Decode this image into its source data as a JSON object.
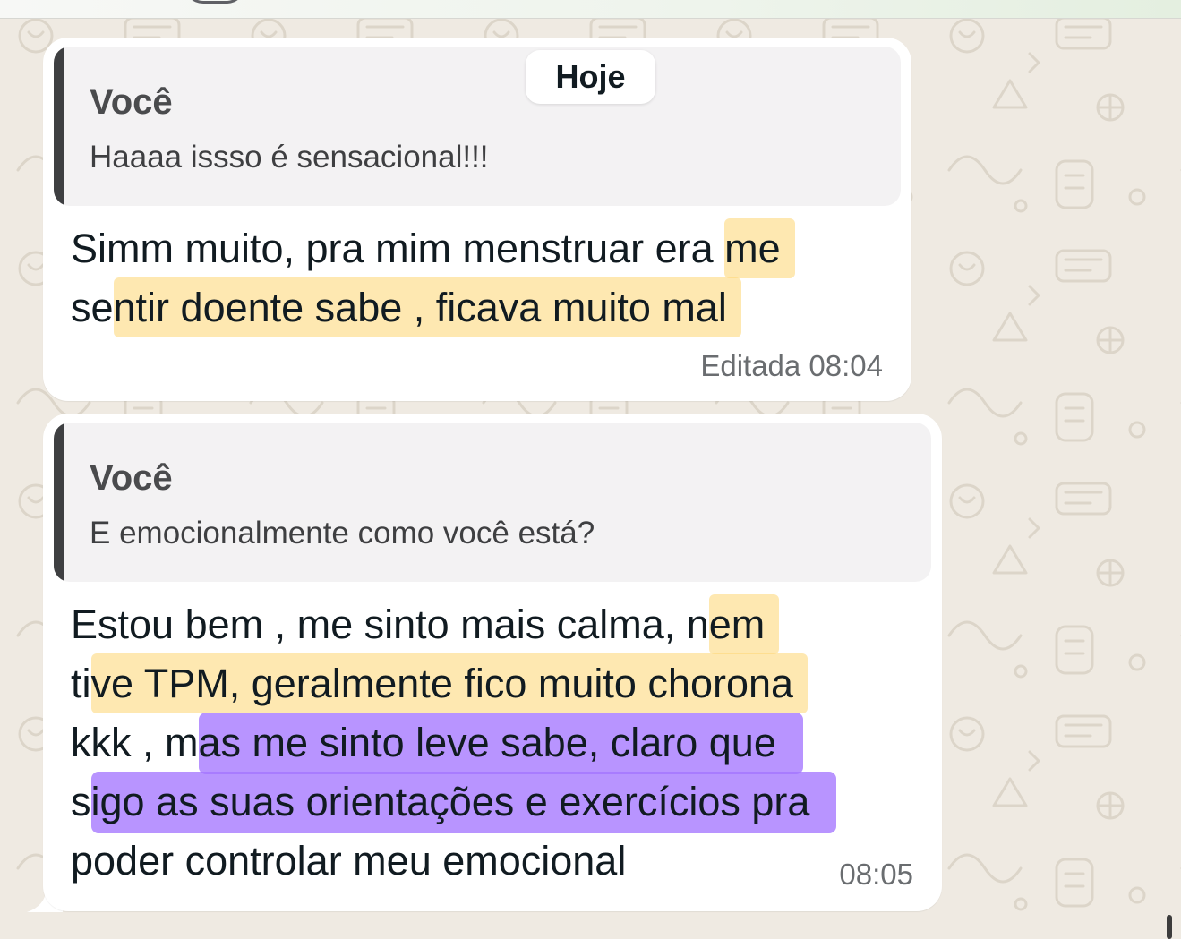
{
  "chat": {
    "date_separator": "Hoje",
    "messages": [
      {
        "quote": {
          "author": "Você",
          "text": "Haaaa issso é sensacional!!!"
        },
        "lines": [
          [
            "Simm muito, pra mim menstruar era ",
            "me"
          ],
          [
            "se",
            "ntir doente sabe , ficava muito mal"
          ]
        ],
        "time": "Editada 08:04"
      },
      {
        "quote": {
          "author": "Você",
          "text": "E emocionalmente como você está?"
        },
        "lines": [
          [
            "Estou bem , me sinto mais calma, n",
            "em"
          ],
          [
            "ti",
            "ve TPM, geralmente fico muito chorona"
          ],
          [
            "kkk , m",
            "as me sinto leve sabe, claro que"
          ],
          [
            "s",
            "igo as suas orientações e exercícios pra"
          ],
          [
            "poder controlar meu emocional"
          ]
        ],
        "time": "08:05"
      }
    ]
  },
  "colors": {
    "wallpaper": "#efeae2",
    "bubble": "#ffffff",
    "quote_background": "#f3f2f3",
    "quote_bar": "#3e3f41",
    "highlight_yellow": "#fdd778",
    "highlight_purple": "#a476ff"
  },
  "icons": [
    "wallpaper-doodle-pattern"
  ]
}
